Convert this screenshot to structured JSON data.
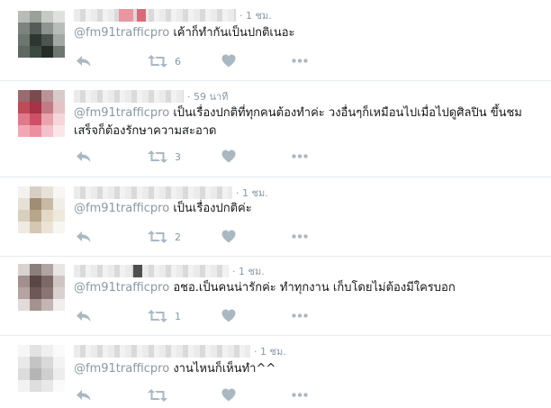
{
  "replies": [
    {
      "time": "· 1 ชม.",
      "handle": "@fm91trafficpro",
      "lines": [
        "เค้าก็ทำกันเป็นปกติเนอะ",
        ""
      ],
      "retweets": "6"
    },
    {
      "time": "· 59 นาที",
      "handle": "@fm91trafficpro",
      "lines": [
        "เป็นเรื่องปกติที่ทุกคนต้องทำค่ะ วงอื่นๆก็เหมือนไปเมื่อไปดูศิลปิน ขึ้นชม",
        "เสร็จก็ต้องรักษาความสะอาด"
      ],
      "retweets": "3"
    },
    {
      "time": "· 1 ชม.",
      "handle": "@fm91trafficpro",
      "lines": [
        "เป็นเรื่องปกติค่ะ",
        ""
      ],
      "retweets": "2"
    },
    {
      "time": "· 1 ชม.",
      "handle": "@fm91trafficpro",
      "lines": [
        "อชอ.เป็นคนน่ารักค่ะ ทำทุกงาน เก็บโดยไม่ต้องมีใครบอก",
        ""
      ],
      "retweets": "1"
    },
    {
      "time": "· 1 ชม.",
      "handle": "@fm91trafficpro",
      "lines": [
        "งานไหนก็เห็นทำ^^",
        ""
      ],
      "retweets": ""
    }
  ],
  "icons": {
    "reply": "reply-arrow-icon",
    "retweet": "retweet-icon",
    "like": "heart-icon",
    "more": "more-dots-icon"
  },
  "colors": {
    "icon": "#aab8c2",
    "muted": "#8899a6",
    "divider": "#e6ecf0",
    "text": "#14171a"
  }
}
